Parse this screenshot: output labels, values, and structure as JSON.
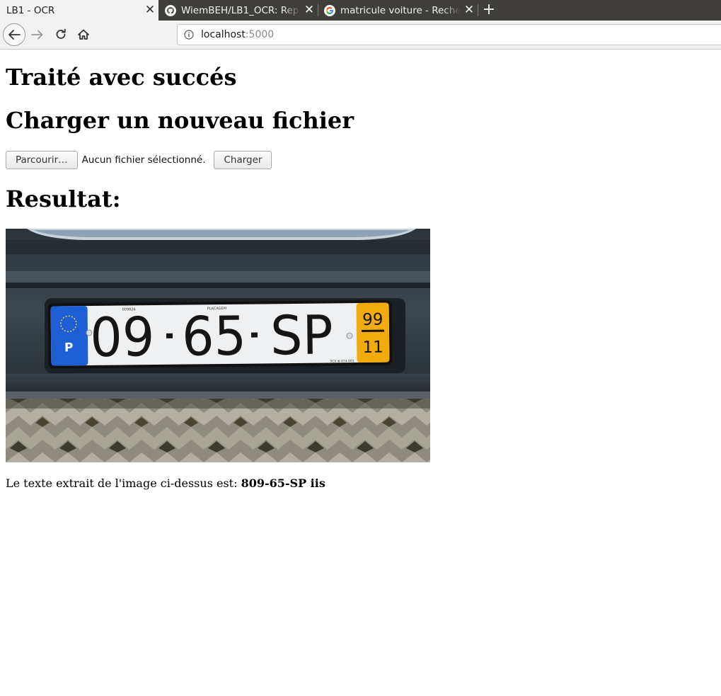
{
  "browser": {
    "tabs": [
      {
        "title": "LB1 - OCR",
        "active": true
      },
      {
        "title": "WiemBEH/LB1_OCR: Rep",
        "active": false,
        "icon": "github-icon"
      },
      {
        "title": "matricule voiture - Reche",
        "active": false,
        "icon": "google-icon"
      }
    ],
    "url_host": "localhost",
    "url_port": ":5000"
  },
  "page": {
    "status_heading": "Traité avec succés",
    "upload_heading": "Charger un nouveau fichier",
    "browse_label": "Parcourir…",
    "no_file_label": "Aucun fichier sélectionné.",
    "upload_label": "Charger",
    "result_heading": "Resultat:",
    "result_prefix": "Le texte extrait de l'image ci-dessus est: ",
    "result_value": "809-65-SP iis"
  },
  "plate": {
    "country": "P",
    "number_left": "09",
    "number_mid": "65",
    "number_right": "SP",
    "year_top": "99",
    "year_bottom": "11",
    "top_small_left": "009826",
    "top_small_right": "PLACAGEM",
    "bottom_small": "SCV ⊕ 074 001",
    "colors": {
      "eu_band": "#1f5fd6",
      "year_band": "#f2ab0c",
      "car_body": "#2e363d"
    }
  }
}
